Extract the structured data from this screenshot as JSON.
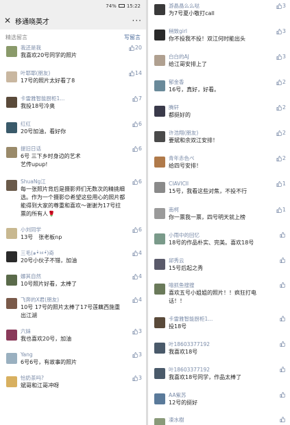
{
  "status": {
    "battery": "74%",
    "time": "15:22"
  },
  "header": {
    "title": "移通晓英才",
    "more": "···"
  },
  "subheader": {
    "label": "精选留言",
    "write": "写留言"
  },
  "left_comments": [
    {
      "name": "我还是我",
      "text": "我喜欢20号同学的照片",
      "likes": "20",
      "avatar_color": "#8a9a6a"
    },
    {
      "name": "叶耶耶(朋友)",
      "text": "17号的照片太好看了8",
      "likes": "14",
      "avatar_color": "#c9b7a0"
    },
    {
      "name": "卡雷雅智能厨柜1...",
      "text": "我投18号冷奥",
      "likes": "7",
      "avatar_color": "#5a4a3a"
    },
    {
      "name": "红红",
      "text": "20号加油，看好你",
      "likes": "6",
      "avatar_color": "#3a5a6a"
    },
    {
      "name": "提旧日话",
      "text": "6号 三下乡时身边的艺术\n艺传upup!",
      "likes": "6",
      "avatar_color": "#9a8a6a"
    },
    {
      "name": "ShuaNg江",
      "text": "每一张照片背后是摄影师们无数次的精挑细选。作为一个摄影😊希望这些用心的照片都能得到大家的尊重和喜欢～谢谢为17号拉票的所有人🌹",
      "likes": "6",
      "avatar_color": "#6a5a4a"
    },
    {
      "name": "小刘同学",
      "text": "13号　张老板np",
      "likes": "6",
      "avatar_color": "#c8b890"
    },
    {
      "name": "三毛(๑•̀ㅂ•́)奇",
      "text": "20号小伙子不错，加油",
      "likes": "4",
      "avatar_color": "#2a2a2a"
    },
    {
      "name": "娜其自然",
      "text": "10号照片好看，太棒了",
      "likes": "4",
      "avatar_color": "#5a6a4a"
    },
    {
      "name": "飞奔的X君(朋友)",
      "text": "10号 17号的照片太棒了17号莲藕西施重出江湖",
      "likes": "4",
      "avatar_color": "#7a5a4a"
    },
    {
      "name": "六妹",
      "text": "我也喜欢20号，加油",
      "likes": "3",
      "avatar_color": "#8a3a5a"
    },
    {
      "name": "Yang",
      "text": "6号6号，有故事的照片",
      "likes": "3",
      "avatar_color": "#9ab0c0"
    },
    {
      "name": "恰奶茶吗?",
      "text": "斌哥和江哥冲呀",
      "likes": "3",
      "avatar_color": "#d8b060"
    }
  ],
  "right_comments": [
    {
      "name": "游晶晶么么哒",
      "text": "为7号夏小敬打call",
      "likes": "3",
      "avatar_color": "#3a3a3a"
    },
    {
      "name": "稍致girl",
      "text": "你不投我不投！双江何时能出头",
      "likes": "3",
      "avatar_color": "#2a2a2a"
    },
    {
      "name": "白白的AJ",
      "text": "给江哥安排上了",
      "likes": "3",
      "avatar_color": "#b0a090"
    },
    {
      "name": "郁金香",
      "text": "16号，真好，好看。",
      "likes": "2",
      "avatar_color": "#6a8a9a"
    },
    {
      "name": "腾轩",
      "text": "都挺好的",
      "likes": "2",
      "avatar_color": "#3a3a4a"
    },
    {
      "name": "许浩翔(朋友)",
      "text": "要斌和余双江安排！",
      "likes": "2",
      "avatar_color": "#4a4a4a"
    },
    {
      "name": "青年赤色ペ",
      "text": "给四号安排！",
      "likes": "2",
      "avatar_color": "#b07a4a"
    },
    {
      "name": "CIAVICII",
      "text": "15号，我看这些对焦，不投不行",
      "likes": "1",
      "avatar_color": "#8a8a8a"
    },
    {
      "name": "南柯",
      "text": "你一票我一票，四号明天就上榜",
      "likes": "1",
      "avatar_color": "#9a9a9a"
    },
    {
      "name": "小雨中的回忆",
      "text": "18号的作品朴实、完美。喜欢18号",
      "likes": "",
      "avatar_color": "#7a9a8a"
    },
    {
      "name": "邱秀云",
      "text": "15号后起之秀",
      "likes": "",
      "avatar_color": "#5a5a6a"
    },
    {
      "name": "嘻抓鱼搜搜",
      "text": "喜欢五号小姐姐的照片！！疯狂打电话！！",
      "likes": "",
      "avatar_color": "#6a7a5a"
    },
    {
      "name": "卡雷雅智能厨柜1...",
      "text": "投18号",
      "likes": "",
      "avatar_color": "#5a4a3a"
    },
    {
      "name": "叶18603377192",
      "text": "我喜欢18号",
      "likes": "",
      "avatar_color": "#4a5a6a"
    },
    {
      "name": "叶18603377192",
      "text": "我喜欢18号同学，作品太棒了",
      "likes": "",
      "avatar_color": "#4a5a6a"
    },
    {
      "name": "AA紫苏",
      "text": "12号的挺好",
      "likes": "",
      "avatar_color": "#5a7a9a"
    },
    {
      "name": "凍水樹",
      "text": "",
      "likes": "",
      "avatar_color": "#8a9a7a"
    }
  ],
  "colors": {
    "link": "#7a8ba8",
    "bar": "#efefef"
  }
}
